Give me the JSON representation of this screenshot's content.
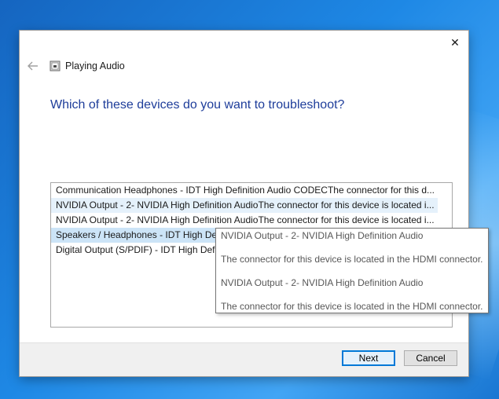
{
  "window": {
    "title": "Playing Audio",
    "close_glyph": "✕"
  },
  "page": {
    "question": "Which of these devices do you want to troubleshoot?"
  },
  "devices": [
    "Communication Headphones - IDT High Definition Audio CODECThe connector for this d...",
    "NVIDIA Output - 2- NVIDIA High Definition AudioThe connector for this device is located i...",
    "NVIDIA Output - 2- NVIDIA High Definition AudioThe connector for this device is located i...",
    "Speakers / Headphones - IDT High Defi",
    "Digital Output (S/PDIF) - IDT High Defi"
  ],
  "tooltip": {
    "lines": [
      "NVIDIA Output - 2- NVIDIA High Definition Audio",
      "The connector for this device is located in the HDMI connector.",
      "NVIDIA Output - 2- NVIDIA High Definition Audio",
      "The connector for this device is located in the HDMI connector."
    ]
  },
  "buttons": {
    "next": "Next",
    "cancel": "Cancel"
  },
  "colors": {
    "heading": "#1e3d9a",
    "selection": "#cce4f7",
    "hover": "#e5f1fb",
    "primary_border": "#0078d7"
  }
}
